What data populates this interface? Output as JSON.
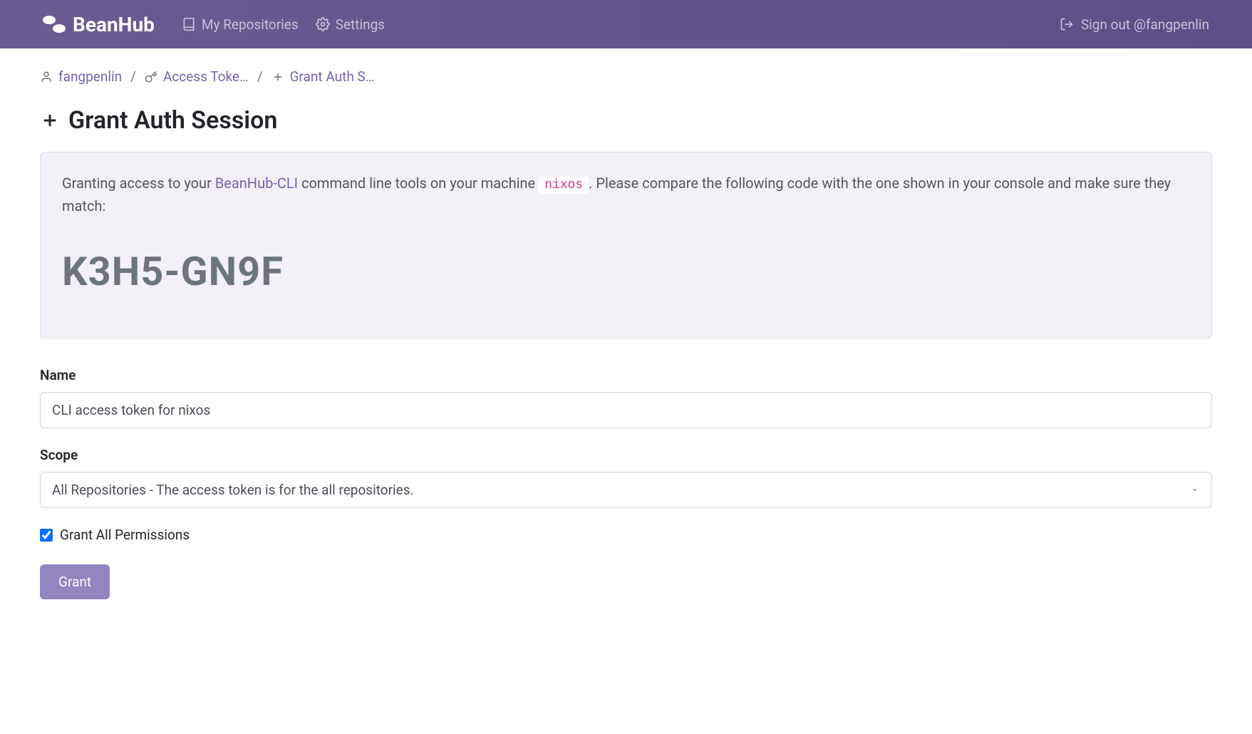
{
  "header": {
    "brand": "BeanHub",
    "nav": {
      "repos_label": "My Repositories",
      "settings_label": "Settings"
    },
    "signout_label": "Sign out @fangpenlin"
  },
  "breadcrumb": {
    "user": "fangpenlin",
    "tokens": "Access Toke…",
    "current": "Grant Auth S…"
  },
  "page": {
    "title": "Grant Auth Session"
  },
  "notice": {
    "text_prefix": "Granting access to your ",
    "cli_link": "BeanHub-CLI",
    "text_mid": " command line tools on your machine ",
    "machine": "nixos",
    "text_suffix": ". Please compare the following code with the one shown in your console and make sure they match:",
    "auth_code": "K3H5-GN9F"
  },
  "form": {
    "name_label": "Name",
    "name_value": "CLI access token for nixos",
    "scope_label": "Scope",
    "scope_value": "All Repositories - The access token is for the all repositories.",
    "grant_all_label": "Grant All Permissions",
    "submit_label": "Grant"
  }
}
